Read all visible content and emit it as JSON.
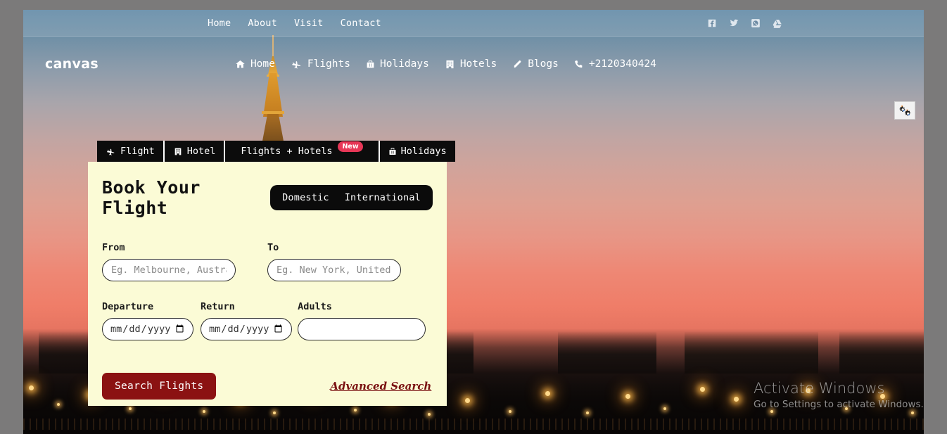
{
  "topbar": {
    "nav": [
      {
        "label": "Home"
      },
      {
        "label": "About"
      },
      {
        "label": "Visit"
      },
      {
        "label": "Contact"
      }
    ],
    "socials": [
      {
        "name": "facebook-icon"
      },
      {
        "name": "twitter-icon"
      },
      {
        "name": "whatsapp-icon"
      },
      {
        "name": "google-drive-icon"
      }
    ]
  },
  "navbar": {
    "brand": "canvas",
    "links": [
      {
        "label": "Home",
        "icon": "home-icon"
      },
      {
        "label": "Flights",
        "icon": "plane-icon"
      },
      {
        "label": "Holidays",
        "icon": "suitcase-icon"
      },
      {
        "label": "Hotels",
        "icon": "building-icon"
      },
      {
        "label": "Blogs",
        "icon": "pen-icon"
      },
      {
        "label": "+2120340424",
        "icon": "phone-icon"
      }
    ]
  },
  "tabs": [
    {
      "label": "Flight",
      "icon": "plane-icon",
      "badge": ""
    },
    {
      "label": "Hotel",
      "icon": "building-icon",
      "badge": ""
    },
    {
      "label": "Flights + Hotels",
      "icon": "",
      "badge": "New"
    },
    {
      "label": "Holidays",
      "icon": "suitcase-icon",
      "badge": ""
    }
  ],
  "card": {
    "title": "Book Your Flight",
    "toggle": {
      "domestic": "Domestic",
      "international": "International"
    },
    "from": {
      "label": "From",
      "placeholder": "Eg. Melbourne, Australia",
      "value": ""
    },
    "to": {
      "label": "To",
      "placeholder": "Eg. New York, United States",
      "value": ""
    },
    "departure": {
      "label": "Departure",
      "placeholder": "mm/dd/yyyy",
      "value": ""
    },
    "return": {
      "label": "Return",
      "placeholder": "mm/dd/yyyy",
      "value": ""
    },
    "adults": {
      "label": "Adults",
      "placeholder": "",
      "value": ""
    },
    "search_button": "Search Flights",
    "advanced_link": "Advanced Search"
  },
  "settings_widget": {
    "name": "settings-gears-icon"
  },
  "watermark": {
    "line1": "Activate Windows",
    "line2": "Go to Settings to activate Windows."
  },
  "colors": {
    "card_bg": "#fbfbd6",
    "tab_bg": "#0c0c0c",
    "badge": "#e83757",
    "button": "#8b1212",
    "link": "#7a1111"
  }
}
